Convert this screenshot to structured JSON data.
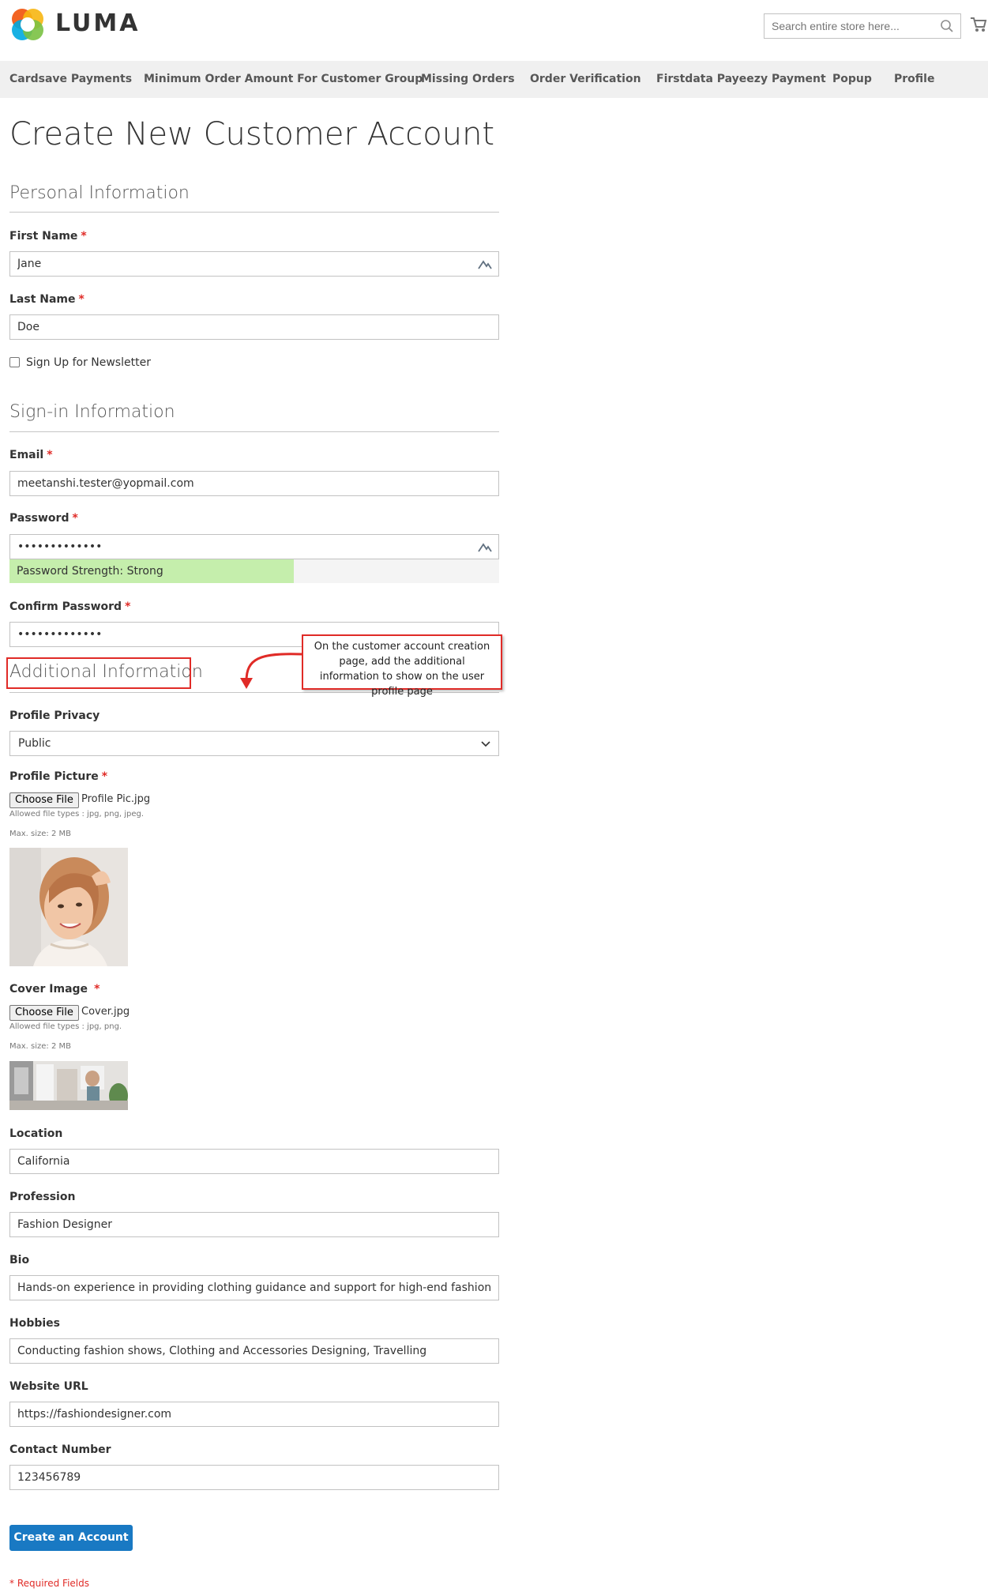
{
  "brand": {
    "name": "LUMA"
  },
  "search": {
    "placeholder": "Search entire store here..."
  },
  "nav": {
    "items": [
      "Cardsave Payments",
      "Minimum Order Amount For Customer Group",
      "Missing Orders",
      "Order Verification",
      "Firstdata Payeezy Payment",
      "Popup",
      "Profile"
    ]
  },
  "page": {
    "title": "Create New Customer Account"
  },
  "personal": {
    "title": "Personal Information",
    "first_name_label": "First Name",
    "first_name_value": "Jane",
    "last_name_label": "Last Name",
    "last_name_value": "Doe",
    "newsletter_label": "Sign Up for Newsletter",
    "newsletter_checked": false
  },
  "signin": {
    "title": "Sign-in Information",
    "email_label": "Email",
    "email_value": "meetanshi.tester@yopmail.com",
    "password_label": "Password",
    "password_value": "•••••••••••••",
    "strength_text": "Password Strength: Strong",
    "strength_fraction": 0.58,
    "confirm_label": "Confirm Password",
    "confirm_value": "•••••••••••••"
  },
  "additional": {
    "title": "Additional Information",
    "callout_text": "On the customer account creation page, add the additional information to show on the user profile page",
    "privacy_label": "Profile Privacy",
    "privacy_value": "Public",
    "picture_label": "Profile Picture",
    "picture_button": "Choose File",
    "picture_file": "Profile Pic.jpg",
    "picture_types": "Allowed file types : jpg, png, jpeg.",
    "picture_max": "Max. size: 2 MB",
    "cover_label": "Cover Image",
    "cover_button": "Choose File",
    "cover_file": "Cover.jpg",
    "cover_types": "Allowed file types : jpg, png.",
    "cover_max": "Max. size: 2 MB",
    "location_label": "Location",
    "location_value": "California",
    "profession_label": "Profession",
    "profession_value": "Fashion Designer",
    "bio_label": "Bio",
    "bio_value": "Hands-on experience in providing clothing guidance and support for high-end fashion and or",
    "hobbies_label": "Hobbies",
    "hobbies_value": "Conducting fashion shows, Clothing and Accessories Designing, Travelling",
    "website_label": "Website URL",
    "website_value": "https://fashiondesigner.com",
    "contact_label": "Contact Number",
    "contact_value": "123456789"
  },
  "actions": {
    "submit_label": "Create an Account"
  },
  "footer_note": "* Required Fields",
  "required_mark": "*",
  "colors": {
    "accent": "#1979c3",
    "required": "#e02b27",
    "strength": "#c5eeac",
    "nav_bg": "#f0f0f0"
  }
}
